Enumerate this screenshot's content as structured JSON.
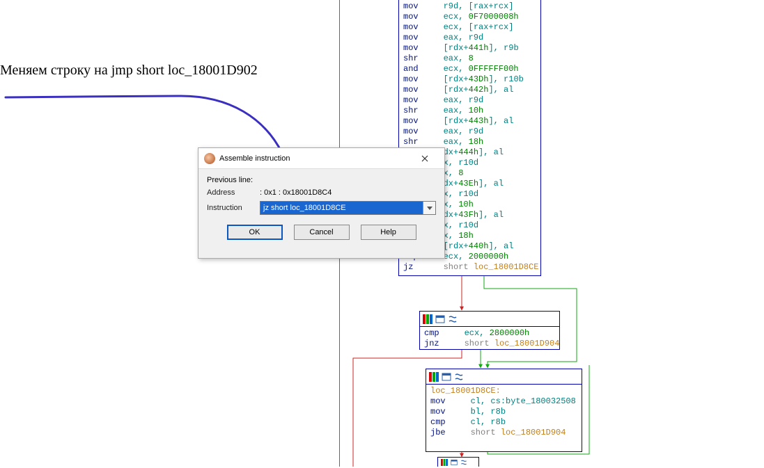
{
  "annotation": "Меняем строку на jmp short loc_18001D902",
  "dialog": {
    "title": "Assemble instruction",
    "previous_line_label": "Previous line:",
    "address_label": "Address",
    "address_value": ": 0x1 : 0x18001D8C4",
    "instruction_label": "Instruction",
    "instruction_value": "jz      short loc_18001D8CE",
    "ok": "OK",
    "cancel": "Cancel",
    "help": "Help"
  },
  "block_top": {
    "lines": [
      [
        "mov",
        "r9d, [rax+rcx]"
      ],
      [
        "mov",
        "ecx, ",
        "0F7000008h"
      ],
      [
        "mov",
        "ecx, [rax+rcx]"
      ],
      [
        "mov",
        "eax, r9d"
      ],
      [
        "mov",
        "[rdx+",
        "441h",
        "], r9b"
      ],
      [
        "shr",
        "eax, ",
        "8"
      ],
      [
        "and",
        "ecx, ",
        "0FFFFFF00h"
      ],
      [
        "mov",
        "[rdx+",
        "43Dh",
        "], r10b"
      ],
      [
        "mov",
        "[rdx+",
        "442h",
        "], al"
      ],
      [
        "mov",
        "eax, r9d"
      ],
      [
        "shr",
        "eax, ",
        "10h"
      ],
      [
        "mov",
        "[rdx+",
        "443h",
        "], al"
      ],
      [
        "mov",
        "eax, r9d"
      ],
      [
        "shr",
        "eax, ",
        "18h"
      ],
      [
        "",
        "dx+",
        "444h",
        "], al"
      ],
      [
        "",
        "x, r10d"
      ],
      [
        "",
        "x, ",
        "8"
      ],
      [
        "",
        "dx+",
        "43Eh",
        "], al"
      ],
      [
        "",
        "x, r10d"
      ],
      [
        "",
        "x, ",
        "10h"
      ],
      [
        "",
        "dx+",
        "43Fh",
        "], al"
      ],
      [
        "",
        "x, r10d"
      ],
      [
        "",
        "x, ",
        "18h"
      ],
      [
        "mov",
        "[rdx+",
        "440h",
        "], al"
      ],
      [
        "cmp",
        "ecx, ",
        "2000000h"
      ],
      [
        "jz",
        "",
        "short loc_18001D8CE"
      ]
    ]
  },
  "block_mid": {
    "lines": [
      [
        "cmp",
        "ecx, ",
        "2800000h"
      ],
      [
        "jnz",
        "",
        "short loc_18001D904"
      ]
    ]
  },
  "block_low": {
    "label": "loc_18001D8CE:",
    "lines": [
      [
        "mov",
        "cl, cs:byte_180032508"
      ],
      [
        "mov",
        "bl, r8b"
      ],
      [
        "cmp",
        "cl, r8b"
      ],
      [
        "jbe",
        "",
        "short loc_18001D904"
      ]
    ]
  }
}
